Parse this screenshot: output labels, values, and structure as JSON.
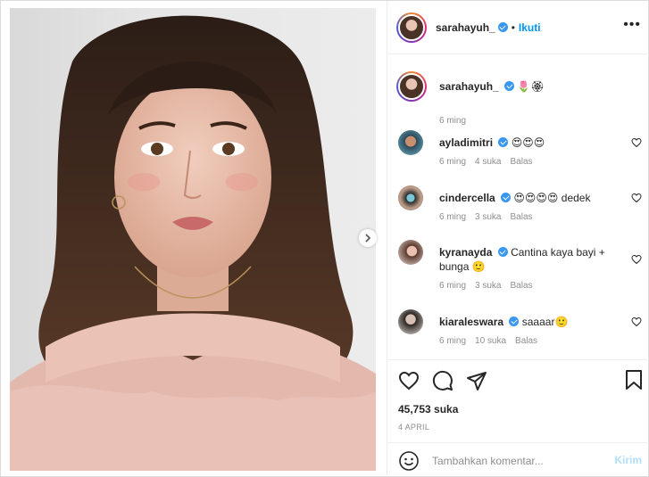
{
  "post": {
    "username": "sarahayuh_",
    "follow_label": "Ikuti",
    "bullet": "•",
    "more_label": "•••"
  },
  "caption": {
    "username": "sarahayuh_",
    "text": "🌷🏵",
    "time": "6 ming"
  },
  "comments": [
    {
      "username": "ayladimitri",
      "text": "😍😍😍",
      "time": "6 ming",
      "likes": "4 suka",
      "reply": "Balas"
    },
    {
      "username": "cindercella",
      "text": "😍😍😍😍 dedek",
      "time": "6 ming",
      "likes": "3 suka",
      "reply": "Balas"
    },
    {
      "username": "kyranayda",
      "text": "Cantina kaya bayi + bunga 🙂",
      "time": "6 ming",
      "likes": "3 suka",
      "reply": "Balas"
    },
    {
      "username": "kiaraleswara",
      "text": "saaaar🙂",
      "time": "6 ming",
      "likes": "10 suka",
      "reply": "Balas"
    }
  ],
  "stats": {
    "likes": "45,753 suka",
    "date": "4 APRIL"
  },
  "composer": {
    "placeholder": "Tambahkan komentar...",
    "post_label": "Kirim"
  },
  "carousel": {
    "slides": 5,
    "active": 1
  },
  "colors": {
    "accent": "#0095f6",
    "verified": "#3897f0",
    "muted": "#8e8e8e"
  }
}
